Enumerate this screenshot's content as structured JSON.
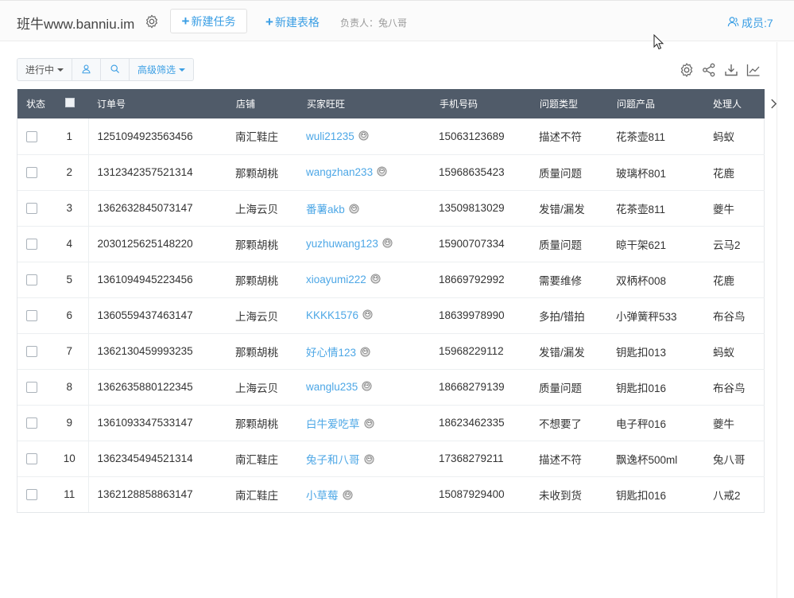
{
  "header": {
    "app_title": "班牛www.banniu.im",
    "new_task_label": "新建任务",
    "new_table_label": "新建表格",
    "owner_text": "负责人：兔八哥",
    "members_label": "成员:7"
  },
  "colors": {
    "accent": "#3a9ee4",
    "table_header_bg": "#505b69",
    "link": "#4da7e6"
  },
  "filters": {
    "status_label": "进行中",
    "advanced_label": "高级筛选"
  },
  "icons": [
    "gear-icon",
    "share-icon",
    "download-icon",
    "line-chart-icon",
    "user-icon",
    "search-icon",
    "chevron-right-icon",
    "wangwang-icon"
  ],
  "table": {
    "columns": [
      "状态",
      "",
      "订单号",
      "店铺",
      "买家旺旺",
      "手机号码",
      "问题类型",
      "问题产品",
      "处理人"
    ],
    "rows": [
      {
        "idx": "1",
        "order": "1251094923563456",
        "shop": "南汇鞋庄",
        "buyer": "wuli21235",
        "phone": "15063123689",
        "type": "描述不符",
        "product": "花茶壶811",
        "handler": "蚂蚁"
      },
      {
        "idx": "2",
        "order": "1312342357521314",
        "shop": "那颗胡桃",
        "buyer": "wangzhan233",
        "phone": "15968635423",
        "type": "质量问题",
        "product": "玻璃杯801",
        "handler": "花鹿"
      },
      {
        "idx": "3",
        "order": "1362632845073147",
        "shop": "上海云贝",
        "buyer": "番薯akb",
        "phone": "13509813029",
        "type": "发错/漏发",
        "product": "花茶壶811",
        "handler": "夔牛"
      },
      {
        "idx": "4",
        "order": "2030125625148220",
        "shop": "那颗胡桃",
        "buyer": "yuzhuwang123",
        "phone": "15900707334",
        "type": "质量问题",
        "product": "晾干架621",
        "handler": "云马2"
      },
      {
        "idx": "5",
        "order": "1361094945223456",
        "shop": "那颗胡桃",
        "buyer": "xioayumi222",
        "phone": "18669792992",
        "type": "需要维修",
        "product": "双柄杯008",
        "handler": "花鹿"
      },
      {
        "idx": "6",
        "order": "1360559437463147",
        "shop": "上海云贝",
        "buyer": "KKKK1576",
        "phone": "18639978990",
        "type": "多拍/错拍",
        "product": "小弹簧秤533",
        "handler": "布谷鸟"
      },
      {
        "idx": "7",
        "order": "1362130459993235",
        "shop": "那颗胡桃",
        "buyer": "好心情123",
        "phone": "15968229112",
        "type": "发错/漏发",
        "product": "钥匙扣013",
        "handler": "蚂蚁"
      },
      {
        "idx": "8",
        "order": "1362635880122345",
        "shop": "上海云贝",
        "buyer": "wanglu235",
        "phone": "18668279139",
        "type": "质量问题",
        "product": "钥匙扣016",
        "handler": "布谷鸟"
      },
      {
        "idx": "9",
        "order": "1361093347533147",
        "shop": "那颗胡桃",
        "buyer": "白牛爱吃草",
        "phone": "18623462335",
        "type": "不想要了",
        "product": "电子秤016",
        "handler": "夔牛"
      },
      {
        "idx": "10",
        "order": "1362345494521314",
        "shop": "南汇鞋庄",
        "buyer": "兔子和八哥",
        "phone": "17368279211",
        "type": "描述不符",
        "product": "飘逸杯500ml",
        "handler": "兔八哥"
      },
      {
        "idx": "11",
        "order": "1362128858863147",
        "shop": "南汇鞋庄",
        "buyer": "小草莓",
        "phone": "15087929400",
        "type": "未收到货",
        "product": "钥匙扣016",
        "handler": "八戒2"
      }
    ]
  }
}
